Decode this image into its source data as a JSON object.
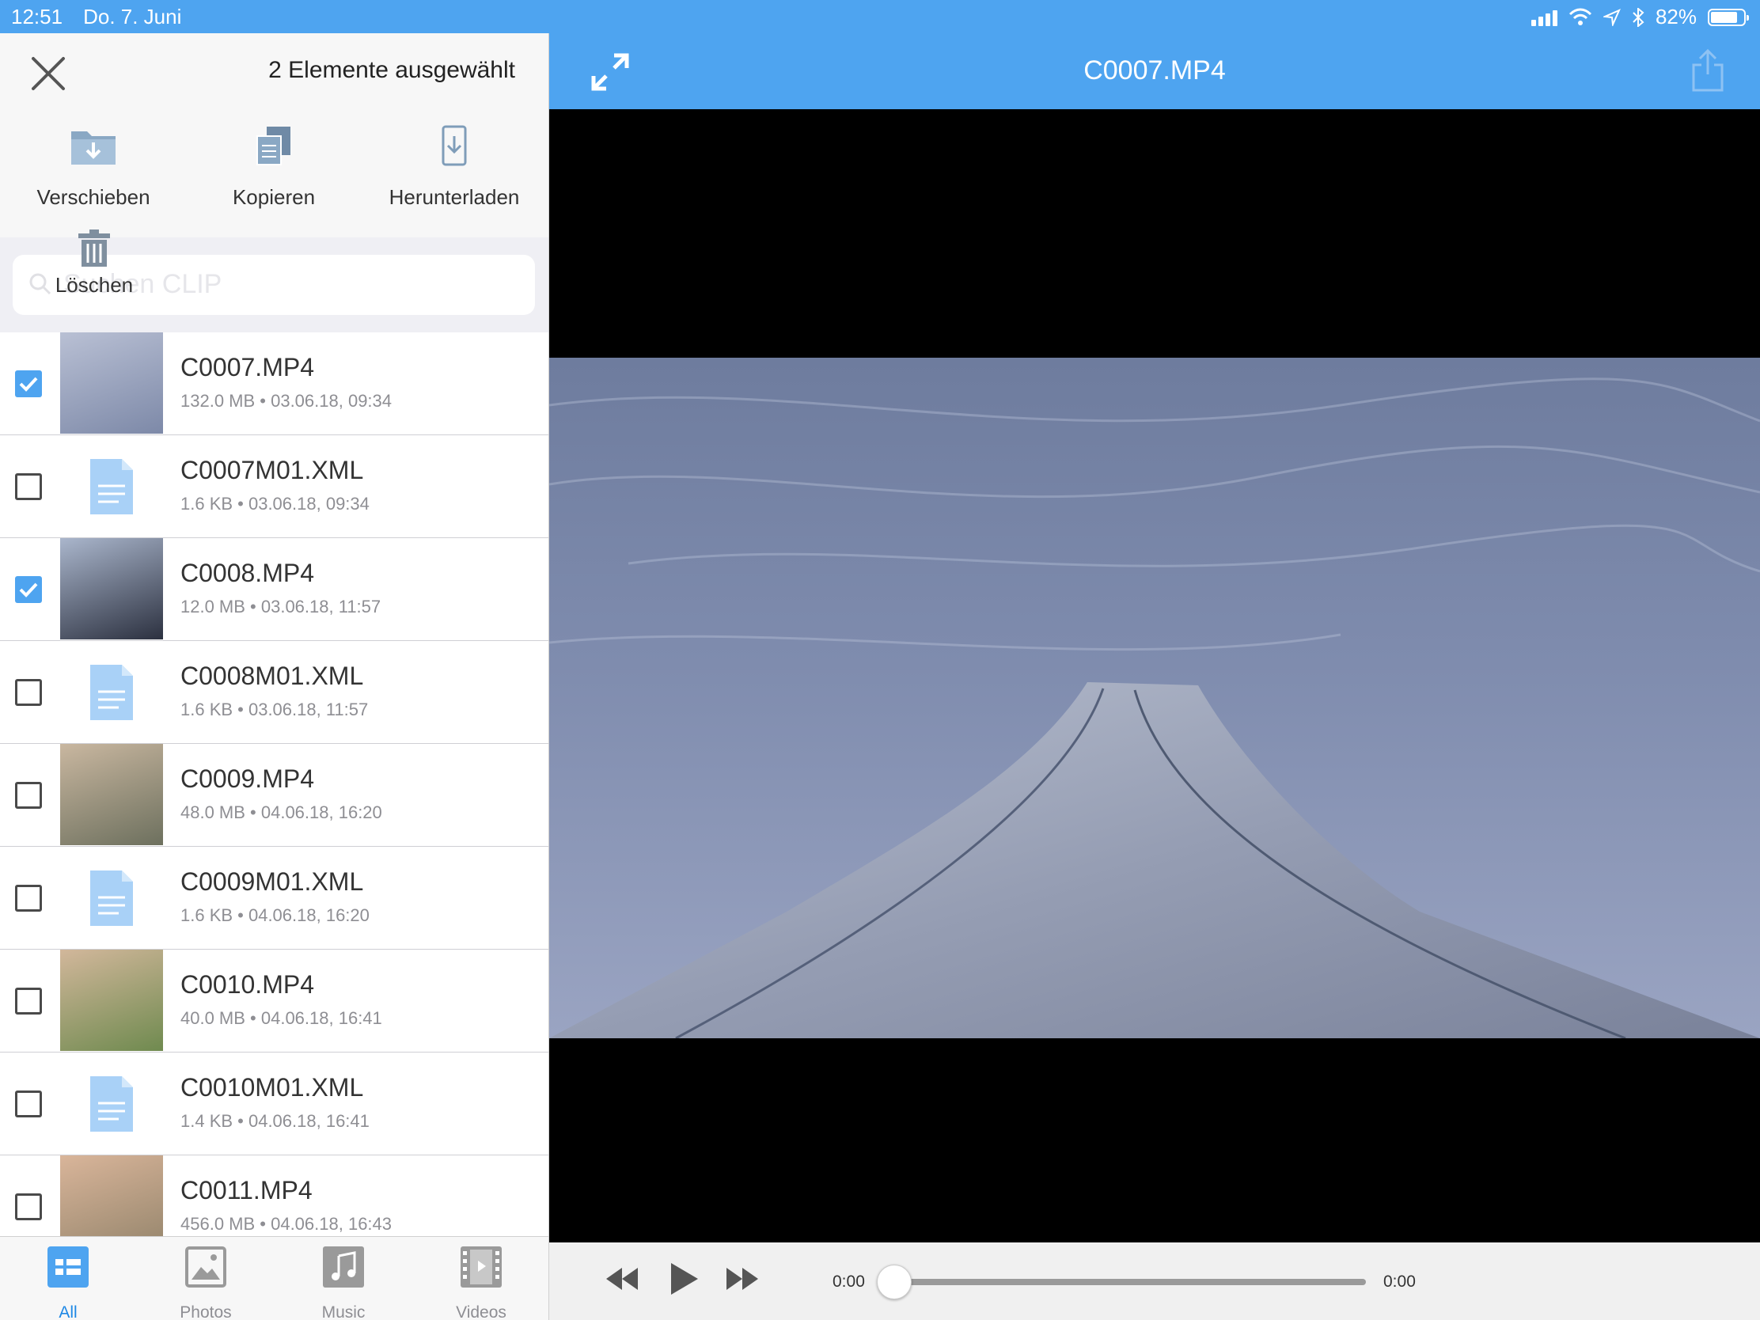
{
  "status_bar": {
    "time": "12:51",
    "date": "Do. 7. Juni",
    "battery": "82%",
    "battery_level": 0.82
  },
  "selection_header": {
    "title": "2 Elemente ausgewählt"
  },
  "actions": {
    "move": "Verschieben",
    "copy": "Kopieren",
    "download": "Herunterladen",
    "delete": "Löschen"
  },
  "search": {
    "placeholder": "Suchen CLIP"
  },
  "files": [
    {
      "name": "C0007.MP4",
      "size": "132.0 MB",
      "date": "03.06.18, 09:34",
      "type": "video",
      "checked": true
    },
    {
      "name": "C0007M01.XML",
      "size": "1.6 KB",
      "date": "03.06.18, 09:34",
      "type": "doc",
      "checked": false
    },
    {
      "name": "C0008.MP4",
      "size": "12.0 MB",
      "date": "03.06.18, 11:57",
      "type": "video",
      "checked": true
    },
    {
      "name": "C0008M01.XML",
      "size": "1.6 KB",
      "date": "03.06.18, 11:57",
      "type": "doc",
      "checked": false
    },
    {
      "name": "C0009.MP4",
      "size": "48.0 MB",
      "date": "04.06.18, 16:20",
      "type": "video",
      "checked": false
    },
    {
      "name": "C0009M01.XML",
      "size": "1.6 KB",
      "date": "04.06.18, 16:20",
      "type": "doc",
      "checked": false
    },
    {
      "name": "C0010.MP4",
      "size": "40.0 MB",
      "date": "04.06.18, 16:41",
      "type": "video",
      "checked": false
    },
    {
      "name": "C0010M01.XML",
      "size": "1.4 KB",
      "date": "04.06.18, 16:41",
      "type": "doc",
      "checked": false
    },
    {
      "name": "C0011.MP4",
      "size": "456.0 MB",
      "date": "04.06.18, 16:43",
      "type": "video",
      "checked": false
    }
  ],
  "meta_separator": "•",
  "tabs": [
    {
      "label": "All",
      "icon": "grid-icon",
      "active": true
    },
    {
      "label": "Photos",
      "icon": "photo-icon",
      "active": false
    },
    {
      "label": "Music",
      "icon": "music-note-icon",
      "active": false
    },
    {
      "label": "Videos",
      "icon": "film-icon",
      "active": false
    }
  ],
  "player": {
    "title": "C0007.MP4",
    "current_time": "0:00",
    "total_time": "0:00",
    "progress": 0
  },
  "colors": {
    "accent": "#4ea4f0",
    "active_tab": "#1e88e5",
    "doc_icon": "#a9d1f7"
  }
}
